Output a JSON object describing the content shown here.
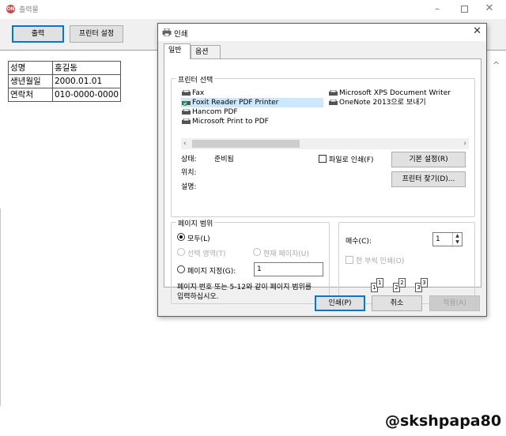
{
  "app": {
    "logo_text": "ON",
    "title": "출력물",
    "toolbar": {
      "print_label": "출력",
      "printer_setup_label": "프린터 설정"
    },
    "info_table": [
      {
        "key": "성명",
        "value": "홍길동"
      },
      {
        "key": "생년월일",
        "value": "2000.01.01"
      },
      {
        "key": "연락처",
        "value": "010-0000-0000"
      }
    ],
    "watermark": "@skshpapa80"
  },
  "dialog": {
    "title": "인쇄",
    "tabs": [
      {
        "label": "일반"
      },
      {
        "label": "옵션"
      }
    ],
    "printer_group": {
      "legend": "프린터 선택",
      "printers": [
        {
          "name": "Fax",
          "selected": false
        },
        {
          "name": "Foxit Reader PDF Printer",
          "selected": true
        },
        {
          "name": "Hancom PDF",
          "selected": false
        },
        {
          "name": "Microsoft Print to PDF",
          "selected": false
        },
        {
          "name": "Microsoft XPS Document Writer",
          "selected": false
        },
        {
          "name": "OneNote 2013으로 보내기",
          "selected": false
        }
      ],
      "status_label": "상태:",
      "status_value": "준비됨",
      "location_label": "위치:",
      "comment_label": "설명:",
      "print_to_file_label": "파일로 인쇄(F)",
      "preferences_label": "기본 설정(R)",
      "find_printer_label": "프린터 찾기(D)..."
    },
    "range_group": {
      "legend": "페이지 범위",
      "all_label": "모두(L)",
      "selection_label": "선택 영역(T)",
      "current_page_label": "현재 페이지(U)",
      "pages_label": "페이지 지정(G):",
      "pages_value": "1",
      "hint_line1": "페이지 번호 또는 5-12와 같이 페이지 범위를",
      "hint_line2": "입력하십시오."
    },
    "copies_group": {
      "copies_label": "매수(C):",
      "copies_value": "1",
      "collate_label": "한 부씩 인쇄(O)",
      "collate_pages": [
        "1",
        "1",
        "2",
        "2",
        "3",
        "3"
      ]
    },
    "buttons": {
      "print": "인쇄(P)",
      "cancel": "취소",
      "apply": "적용(A)"
    }
  }
}
